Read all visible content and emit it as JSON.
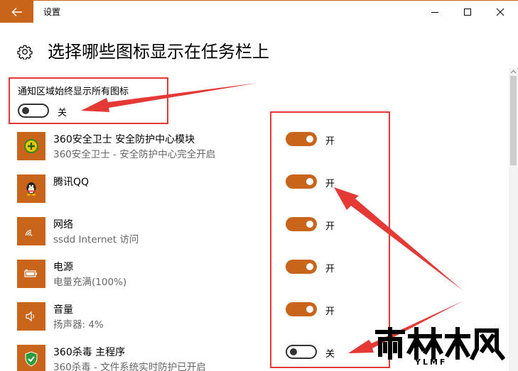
{
  "window": {
    "title": "设置"
  },
  "header": {
    "title": "选择哪些图标显示在任务栏上"
  },
  "master": {
    "label": "通知区域始终显示所有图标",
    "state": "关"
  },
  "apps": [
    {
      "name": "360安全卫士 安全防护中心模块",
      "desc": "360安全卫士 - 安全防护中心完全开启",
      "state": "开",
      "icon": "360-shield-plus-icon"
    },
    {
      "name": "腾讯QQ",
      "desc": "",
      "state": "开",
      "icon": "qq-penguin-icon"
    },
    {
      "name": "网络",
      "desc": "ssdd Internet 访问",
      "state": "开",
      "icon": "wifi-icon"
    },
    {
      "name": "电源",
      "desc": "电量充满(100%)",
      "state": "开",
      "icon": "battery-icon"
    },
    {
      "name": "音量",
      "desc": "扬声器: 4%",
      "state": "开",
      "icon": "speaker-icon"
    },
    {
      "name": "360杀毒 主程序",
      "desc": "360杀毒 - 文件系统实时防护已开启",
      "state": "关",
      "icon": "360-antivirus-shield-icon"
    }
  ],
  "colors": {
    "accent": "#c8651b",
    "annotation": "#e53935"
  },
  "watermark": {
    "text": "雨林木风",
    "latin": "YLMF"
  }
}
